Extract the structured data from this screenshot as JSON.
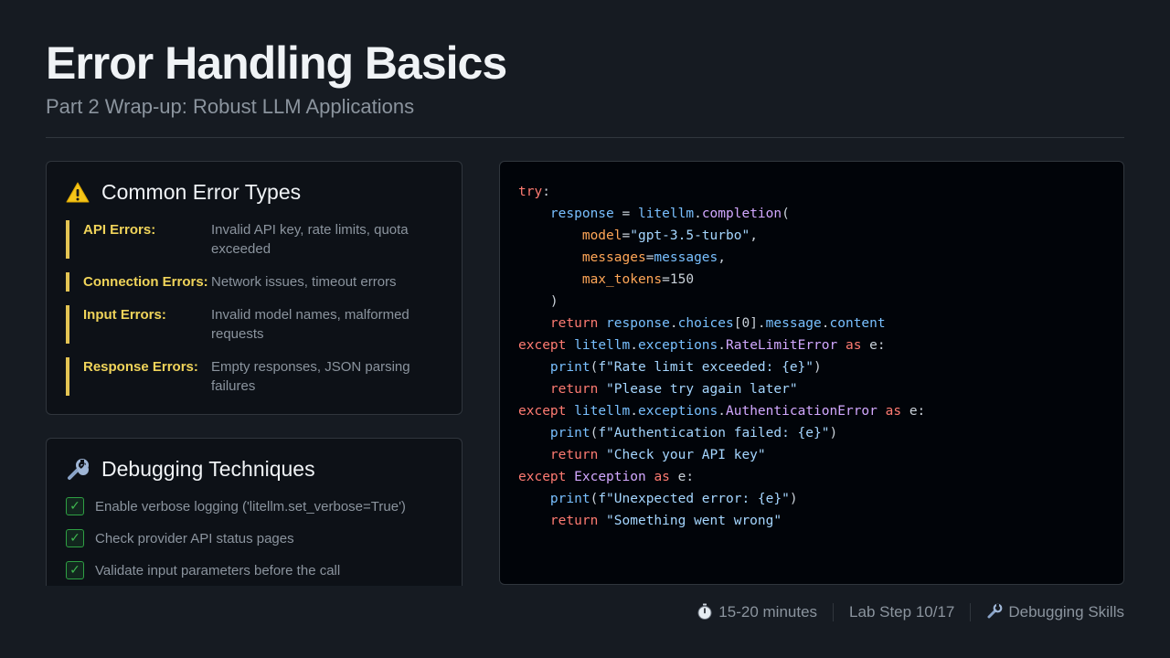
{
  "header": {
    "title": "Error Handling Basics",
    "subtitle": "Part 2 Wrap-up: Robust LLM Applications"
  },
  "errors_card": {
    "icon": "warning-icon",
    "title": "Common Error Types",
    "accent_color": "#e3c453",
    "items": [
      {
        "name": "API Errors:",
        "desc": "Invalid API key, rate limits, quota exceeded"
      },
      {
        "name": "Connection Errors:",
        "desc": "Network issues, timeout errors"
      },
      {
        "name": "Input Errors:",
        "desc": "Invalid model names, malformed requests"
      },
      {
        "name": "Response Errors:",
        "desc": "Empty responses, JSON parsing failures"
      }
    ]
  },
  "debug_card": {
    "icon": "wrench-icon",
    "title": "Debugging Techniques",
    "items": [
      {
        "label": "Enable verbose logging ('litellm.set_verbose=True')"
      },
      {
        "label": "Check provider API status pages"
      },
      {
        "label": "Validate input parameters before the call"
      }
    ]
  },
  "code": {
    "lines": [
      "try:",
      "    response = litellm.completion(",
      "        model=\"gpt-3.5-turbo\",",
      "        messages=messages,",
      "        max_tokens=150",
      "    )",
      "    return response.choices[0].message.content",
      "except litellm.exceptions.RateLimitError as e:",
      "    print(f\"Rate limit exceeded: {e}\")",
      "    return \"Please try again later\"",
      "except litellm.exceptions.AuthenticationError as e:",
      "    print(f\"Authentication failed: {e}\")",
      "    return \"Check your API key\"",
      "except Exception as e:",
      "    print(f\"Unexpected error: {e}\")",
      "    return \"Something went wrong\""
    ]
  },
  "footer": {
    "duration_icon": "stopwatch-icon",
    "duration": "15-20 minutes",
    "step": "Lab Step 10/17",
    "skill_icon": "wrench-icon",
    "skill": "Debugging Skills"
  }
}
